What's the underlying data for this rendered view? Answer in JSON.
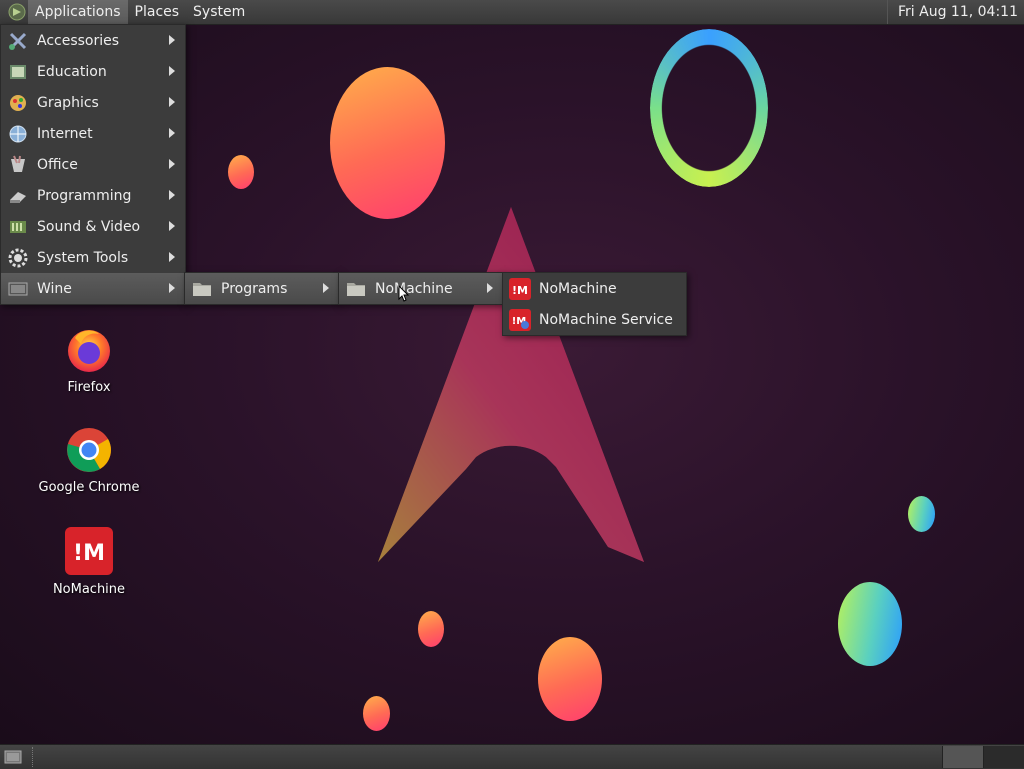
{
  "top_panel": {
    "menus": [
      {
        "label": "Applications",
        "active": true
      },
      {
        "label": "Places"
      },
      {
        "label": "System"
      }
    ],
    "clock": "Fri Aug 11, 04:11"
  },
  "applications_menu": {
    "items": [
      {
        "label": "Accessories",
        "icon": "accessories-icon"
      },
      {
        "label": "Education",
        "icon": "education-icon"
      },
      {
        "label": "Graphics",
        "icon": "graphics-icon"
      },
      {
        "label": "Internet",
        "icon": "internet-icon"
      },
      {
        "label": "Office",
        "icon": "office-icon"
      },
      {
        "label": "Programming",
        "icon": "programming-icon"
      },
      {
        "label": "Sound & Video",
        "icon": "sound-video-icon"
      },
      {
        "label": "System Tools",
        "icon": "system-tools-icon"
      },
      {
        "label": "Wine",
        "icon": "wine-icon",
        "highlighted": true
      }
    ]
  },
  "wine_menu": {
    "items": [
      {
        "label": "Programs",
        "icon": "folder-icon",
        "highlighted": true
      }
    ]
  },
  "programs_menu": {
    "items": [
      {
        "label": "NoMachine",
        "icon": "folder-icon",
        "highlighted": true
      }
    ]
  },
  "nomachine_menu": {
    "items": [
      {
        "label": "NoMachine",
        "icon": "nomachine-icon"
      },
      {
        "label": "NoMachine Service",
        "icon": "nomachine-service-icon"
      }
    ]
  },
  "desktop_icons": [
    {
      "label": "Firefox",
      "icon": "firefox-icon"
    },
    {
      "label": "Google Chrome",
      "icon": "chrome-icon"
    },
    {
      "label": "NoMachine",
      "icon": "nomachine-icon"
    }
  ],
  "colors": {
    "panel": "#404040",
    "menu_bg": "#3c3c3c",
    "wallpaper_bg": "#2a1229",
    "nomachine_red": "#d8232a",
    "accent_pink": "#ff3d7f"
  }
}
